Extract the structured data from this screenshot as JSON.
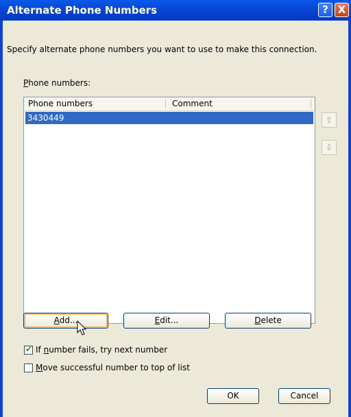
{
  "window": {
    "title": "Alternate Phone Numbers",
    "help_glyph": "?",
    "close_glyph": "X"
  },
  "description": "Specify alternate phone numbers you want to use to make this connection.",
  "phone_label": {
    "pre": "",
    "accel": "P",
    "post": "hone numbers:"
  },
  "list": {
    "columns": [
      "Phone numbers",
      "Comment"
    ],
    "rows": [
      {
        "number": "3430449",
        "comment": "",
        "selected": true
      }
    ]
  },
  "move_up_icon": "⇧",
  "move_down_icon": "⇩",
  "buttons": {
    "add": {
      "accel": "A",
      "rest": "dd..."
    },
    "edit": {
      "accel": "E",
      "rest": "dit..."
    },
    "delete": {
      "accel": "D",
      "rest": "elete"
    },
    "ok": "OK",
    "cancel": "Cancel"
  },
  "options": {
    "try_next": {
      "pre": "If ",
      "accel": "n",
      "post": "umber fails, try next number",
      "checked": true
    },
    "move_top": {
      "pre": "",
      "accel": "M",
      "post": "ove successful number to top of list",
      "checked": false
    }
  },
  "colors": {
    "title_bar": "#0a46d6",
    "selection": "#316ac5",
    "dialog_bg": "#ece9d8"
  }
}
